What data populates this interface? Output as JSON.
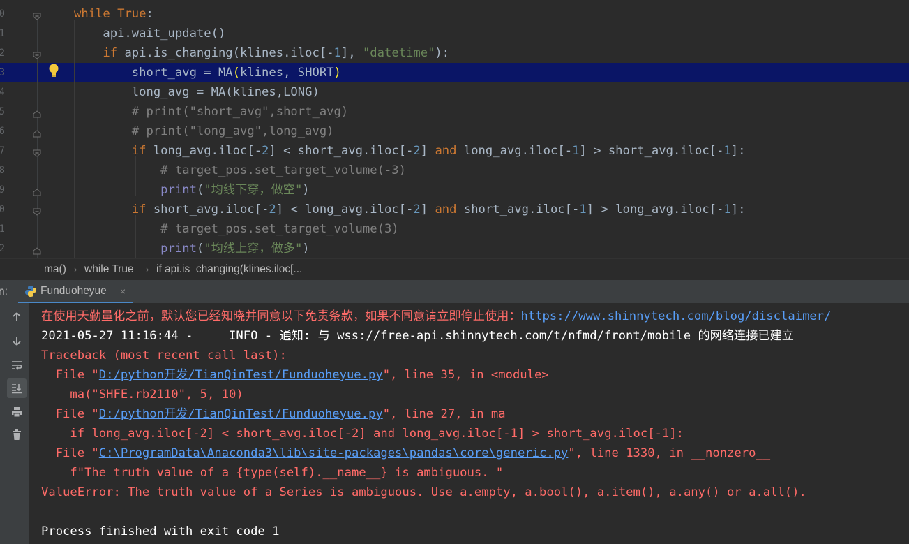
{
  "editor": {
    "line_numbers": [
      "0",
      "1",
      "2",
      "3",
      "4",
      "5",
      "6",
      "7",
      "8",
      "9",
      "0",
      "1",
      "2"
    ],
    "lines": [
      {
        "tokens": [
          {
            "c": "kw",
            "t": "while "
          },
          {
            "c": "kw",
            "t": "True"
          },
          {
            "c": "",
            "t": ":"
          }
        ]
      },
      {
        "tokens": [
          {
            "c": "",
            "t": "    api.wait_update()"
          }
        ]
      },
      {
        "tokens": [
          {
            "c": "kw",
            "t": "    if "
          },
          {
            "c": "",
            "t": "api.is_changing(klines.iloc[-"
          },
          {
            "c": "num",
            "t": "1"
          },
          {
            "c": "",
            "t": "], "
          },
          {
            "c": "str",
            "t": "\"datetime\""
          },
          {
            "c": "",
            "t": "):"
          }
        ]
      },
      {
        "tokens": [
          {
            "c": "",
            "t": "        short_avg = MA"
          },
          {
            "c": "bracket",
            "t": "("
          },
          {
            "c": "",
            "t": "klines, SHORT"
          },
          {
            "c": "bracket",
            "t": ")"
          }
        ]
      },
      {
        "tokens": [
          {
            "c": "",
            "t": "        long_avg = MA(klines,LONG)"
          }
        ]
      },
      {
        "tokens": [
          {
            "c": "cm",
            "t": "        # print(\"short_avg\",short_avg)"
          }
        ]
      },
      {
        "tokens": [
          {
            "c": "cm",
            "t": "        # print(\"long_avg\",long_avg)"
          }
        ]
      },
      {
        "tokens": [
          {
            "c": "kw",
            "t": "        if "
          },
          {
            "c": "",
            "t": "long_avg.iloc[-"
          },
          {
            "c": "num",
            "t": "2"
          },
          {
            "c": "",
            "t": "] < short_avg.iloc[-"
          },
          {
            "c": "num",
            "t": "2"
          },
          {
            "c": "",
            "t": "] "
          },
          {
            "c": "kw",
            "t": "and "
          },
          {
            "c": "",
            "t": "long_avg.iloc[-"
          },
          {
            "c": "num",
            "t": "1"
          },
          {
            "c": "",
            "t": "] > short_avg.iloc[-"
          },
          {
            "c": "num",
            "t": "1"
          },
          {
            "c": "",
            "t": "]:"
          }
        ]
      },
      {
        "tokens": [
          {
            "c": "cm",
            "t": "            # target_pos.set_target_volume(-3)"
          }
        ]
      },
      {
        "tokens": [
          {
            "c": "bi",
            "t": "            print"
          },
          {
            "c": "",
            "t": "("
          },
          {
            "c": "str",
            "t": "\"均线下穿，做空\""
          },
          {
            "c": "",
            "t": ")"
          }
        ]
      },
      {
        "tokens": [
          {
            "c": "kw",
            "t": "        if "
          },
          {
            "c": "",
            "t": "short_avg.iloc[-"
          },
          {
            "c": "num",
            "t": "2"
          },
          {
            "c": "",
            "t": "] < long_avg.iloc[-"
          },
          {
            "c": "num",
            "t": "2"
          },
          {
            "c": "",
            "t": "] "
          },
          {
            "c": "kw",
            "t": "and "
          },
          {
            "c": "",
            "t": "short_avg.iloc[-"
          },
          {
            "c": "num",
            "t": "1"
          },
          {
            "c": "",
            "t": "] > long_avg.iloc[-"
          },
          {
            "c": "num",
            "t": "1"
          },
          {
            "c": "",
            "t": "]:"
          }
        ]
      },
      {
        "tokens": [
          {
            "c": "cm",
            "t": "            # target_pos.set_target_volume(3)"
          }
        ]
      },
      {
        "tokens": [
          {
            "c": "bi",
            "t": "            print"
          },
          {
            "c": "",
            "t": "("
          },
          {
            "c": "str",
            "t": "\"均线上穿，做多\""
          },
          {
            "c": "",
            "t": ")"
          }
        ]
      }
    ]
  },
  "breadcrumb": {
    "items": [
      "ma()",
      "while True",
      "if api.is_changing(klines.iloc[..."
    ],
    "separator": "›"
  },
  "run_panel": {
    "label": "n:",
    "tab_title": "Funduoheyue",
    "tab_close": "×"
  },
  "toolbar": {
    "buttons": [
      "up-arrow-icon",
      "down-arrow-icon",
      "soft-wrap-icon",
      "scroll-to-end-icon",
      "print-icon",
      "trash-icon"
    ]
  },
  "console": {
    "lines": [
      {
        "cls": "err",
        "parts": [
          {
            "t": "在使用天勤量化之前，默认您已经知晓并同意以下免责条款，如果不同意请立即停止使用："
          },
          {
            "t": "https://www.shinnytech.com/blog/disclaimer/",
            "link": true
          }
        ]
      },
      {
        "cls": "normal",
        "parts": [
          {
            "t": "2021-05-27 11:16:44 -     INFO - 通知: 与 wss://free-api.shinnytech.com/t/nfmd/front/mobile 的网络连接已建立"
          }
        ]
      },
      {
        "cls": "err",
        "parts": [
          {
            "t": "Traceback (most recent call last):"
          }
        ]
      },
      {
        "cls": "err",
        "parts": [
          {
            "t": "  File \""
          },
          {
            "t": "D:/python开发/TianQinTest/Funduoheyue.py",
            "link": true
          },
          {
            "t": "\", line 35, in <module>"
          }
        ]
      },
      {
        "cls": "err",
        "parts": [
          {
            "t": "    ma(\"SHFE.rb2110\", 5, 10)"
          }
        ]
      },
      {
        "cls": "err",
        "parts": [
          {
            "t": "  File \""
          },
          {
            "t": "D:/python开发/TianQinTest/Funduoheyue.py",
            "link": true
          },
          {
            "t": "\", line 27, in ma"
          }
        ]
      },
      {
        "cls": "err",
        "parts": [
          {
            "t": "    if long_avg.iloc[-2] < short_avg.iloc[-2] and long_avg.iloc[-1] > short_avg.iloc[-1]:"
          }
        ]
      },
      {
        "cls": "err",
        "parts": [
          {
            "t": "  File \""
          },
          {
            "t": "C:\\ProgramData\\Anaconda3\\lib\\site-packages\\pandas\\core\\generic.py",
            "link": true
          },
          {
            "t": "\", line 1330, in __nonzero__"
          }
        ]
      },
      {
        "cls": "err",
        "parts": [
          {
            "t": "    f\"The truth value of a {type(self).__name__} is ambiguous. \""
          }
        ]
      },
      {
        "cls": "err",
        "parts": [
          {
            "t": "ValueError: The truth value of a Series is ambiguous. Use a.empty, a.bool(), a.item(), a.any() or a.all()."
          }
        ]
      },
      {
        "cls": "normal",
        "parts": [
          {
            "t": ""
          }
        ]
      },
      {
        "cls": "normal",
        "parts": [
          {
            "t": "Process finished with exit code 1"
          }
        ]
      }
    ]
  }
}
